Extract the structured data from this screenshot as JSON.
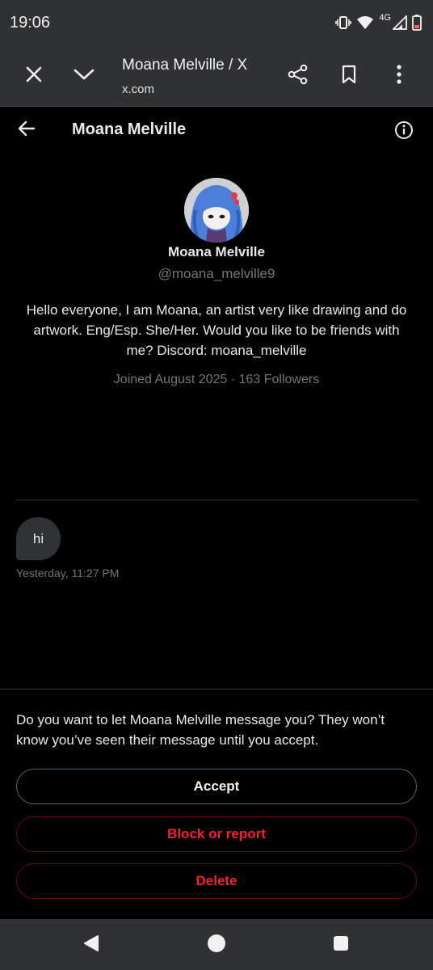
{
  "status_bar": {
    "time": "19:06",
    "network_label": "4G",
    "icons": [
      "vibrate-icon",
      "wifi-icon",
      "signal-icon",
      "battery-icon"
    ],
    "battery_color": "#ff5a4e"
  },
  "browser": {
    "page_title": "Moana Melville / X",
    "url": "x.com",
    "icons": [
      "close-icon",
      "chevron-down-icon",
      "share-icon",
      "bookmark-icon",
      "more-vert-icon"
    ]
  },
  "conversation": {
    "title": "Moana Melville",
    "icons": [
      "back-arrow-icon",
      "info-icon"
    ]
  },
  "profile": {
    "name": "Moana Melville",
    "handle": "@moana_melville9",
    "bio": "Hello everyone, I am Moana, an artist very like drawing and do artwork. Eng/Esp. She/Her. Would you like to be friends with me? Discord: moana_melville",
    "joined": "Joined August 2025",
    "separator": "·",
    "followers": "163 Followers"
  },
  "messages": [
    {
      "text": "hi",
      "timestamp": "Yesterday, 11:27 PM"
    }
  ],
  "request": {
    "prompt": "Do you want to let Moana Melville message you? They won’t know you’ve seen their message until you accept.",
    "accept_label": "Accept",
    "block_label": "Block or report",
    "delete_label": "Delete"
  },
  "nav": {
    "icons": [
      "back-triangle-icon",
      "home-circle-icon",
      "recents-square-icon"
    ]
  },
  "colors": {
    "background": "#000000",
    "chrome": "#2f3133",
    "text_primary": "#e7e9ea",
    "text_secondary": "#71767b",
    "bubble": "#2f3336",
    "danger": "#f4212e"
  }
}
